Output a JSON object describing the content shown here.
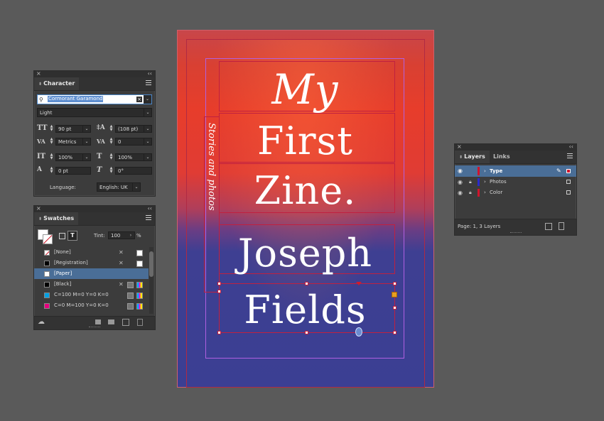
{
  "character": {
    "close": "×",
    "collapse": "‹‹",
    "tab": "Character",
    "font_family": "Cormorant Garamond",
    "font_style": "Light",
    "size": "90 pt",
    "leading": "(108 pt)",
    "kerning": "Metrics",
    "tracking": "0",
    "vscale": "100%",
    "hscale": "100%",
    "baseline": "0 pt",
    "skew": "0°",
    "language_label": "Language:",
    "language": "English: UK"
  },
  "swatches": {
    "close": "×",
    "collapse": "‹‹",
    "tab": "Swatches",
    "tint_label": "Tint:",
    "tint": "100",
    "tint_unit": "%",
    "items": [
      {
        "name": "[None]",
        "color": "none"
      },
      {
        "name": "[Registration]",
        "color": "#000000"
      },
      {
        "name": "[Paper]",
        "color": "#ffffff"
      },
      {
        "name": "[Black]",
        "color": "#000000"
      },
      {
        "name": "C=100 M=0 Y=0 K=0",
        "color": "#00a0e3"
      },
      {
        "name": "C=0 M=100 Y=0 K=0",
        "color": "#e5007e"
      }
    ]
  },
  "layers": {
    "close": "×",
    "collapse": "‹‹",
    "tab_layers": "Layers",
    "tab_links": "Links",
    "items": [
      {
        "name": "Type",
        "color": "#d0142c"
      },
      {
        "name": "Photos",
        "color": "#2a2acc"
      },
      {
        "name": "Color",
        "color": "#d0142c"
      }
    ],
    "status": "Page: 1, 3 Layers"
  },
  "page": {
    "line1": "My",
    "line2": "First",
    "line3": "Zine.",
    "line4": "Joseph",
    "line5": "Fields",
    "sidebar": "Stories and photos",
    "top_color": "#e53a2c",
    "bottom_color": "#3a3f95"
  }
}
